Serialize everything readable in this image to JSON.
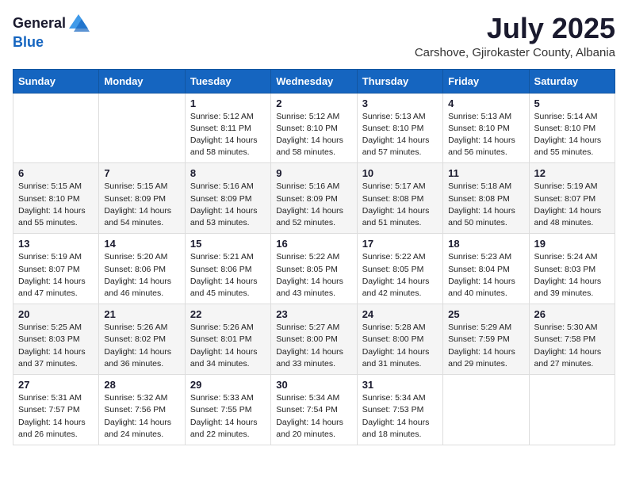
{
  "header": {
    "logo_general": "General",
    "logo_blue": "Blue",
    "month": "July 2025",
    "location": "Carshove, Gjirokaster County, Albania"
  },
  "weekdays": [
    "Sunday",
    "Monday",
    "Tuesday",
    "Wednesday",
    "Thursday",
    "Friday",
    "Saturday"
  ],
  "weeks": [
    [
      {
        "day": "",
        "sunrise": "",
        "sunset": "",
        "daylight": ""
      },
      {
        "day": "",
        "sunrise": "",
        "sunset": "",
        "daylight": ""
      },
      {
        "day": "1",
        "sunrise": "Sunrise: 5:12 AM",
        "sunset": "Sunset: 8:11 PM",
        "daylight": "Daylight: 14 hours and 58 minutes."
      },
      {
        "day": "2",
        "sunrise": "Sunrise: 5:12 AM",
        "sunset": "Sunset: 8:10 PM",
        "daylight": "Daylight: 14 hours and 58 minutes."
      },
      {
        "day": "3",
        "sunrise": "Sunrise: 5:13 AM",
        "sunset": "Sunset: 8:10 PM",
        "daylight": "Daylight: 14 hours and 57 minutes."
      },
      {
        "day": "4",
        "sunrise": "Sunrise: 5:13 AM",
        "sunset": "Sunset: 8:10 PM",
        "daylight": "Daylight: 14 hours and 56 minutes."
      },
      {
        "day": "5",
        "sunrise": "Sunrise: 5:14 AM",
        "sunset": "Sunset: 8:10 PM",
        "daylight": "Daylight: 14 hours and 55 minutes."
      }
    ],
    [
      {
        "day": "6",
        "sunrise": "Sunrise: 5:15 AM",
        "sunset": "Sunset: 8:10 PM",
        "daylight": "Daylight: 14 hours and 55 minutes."
      },
      {
        "day": "7",
        "sunrise": "Sunrise: 5:15 AM",
        "sunset": "Sunset: 8:09 PM",
        "daylight": "Daylight: 14 hours and 54 minutes."
      },
      {
        "day": "8",
        "sunrise": "Sunrise: 5:16 AM",
        "sunset": "Sunset: 8:09 PM",
        "daylight": "Daylight: 14 hours and 53 minutes."
      },
      {
        "day": "9",
        "sunrise": "Sunrise: 5:16 AM",
        "sunset": "Sunset: 8:09 PM",
        "daylight": "Daylight: 14 hours and 52 minutes."
      },
      {
        "day": "10",
        "sunrise": "Sunrise: 5:17 AM",
        "sunset": "Sunset: 8:08 PM",
        "daylight": "Daylight: 14 hours and 51 minutes."
      },
      {
        "day": "11",
        "sunrise": "Sunrise: 5:18 AM",
        "sunset": "Sunset: 8:08 PM",
        "daylight": "Daylight: 14 hours and 50 minutes."
      },
      {
        "day": "12",
        "sunrise": "Sunrise: 5:19 AM",
        "sunset": "Sunset: 8:07 PM",
        "daylight": "Daylight: 14 hours and 48 minutes."
      }
    ],
    [
      {
        "day": "13",
        "sunrise": "Sunrise: 5:19 AM",
        "sunset": "Sunset: 8:07 PM",
        "daylight": "Daylight: 14 hours and 47 minutes."
      },
      {
        "day": "14",
        "sunrise": "Sunrise: 5:20 AM",
        "sunset": "Sunset: 8:06 PM",
        "daylight": "Daylight: 14 hours and 46 minutes."
      },
      {
        "day": "15",
        "sunrise": "Sunrise: 5:21 AM",
        "sunset": "Sunset: 8:06 PM",
        "daylight": "Daylight: 14 hours and 45 minutes."
      },
      {
        "day": "16",
        "sunrise": "Sunrise: 5:22 AM",
        "sunset": "Sunset: 8:05 PM",
        "daylight": "Daylight: 14 hours and 43 minutes."
      },
      {
        "day": "17",
        "sunrise": "Sunrise: 5:22 AM",
        "sunset": "Sunset: 8:05 PM",
        "daylight": "Daylight: 14 hours and 42 minutes."
      },
      {
        "day": "18",
        "sunrise": "Sunrise: 5:23 AM",
        "sunset": "Sunset: 8:04 PM",
        "daylight": "Daylight: 14 hours and 40 minutes."
      },
      {
        "day": "19",
        "sunrise": "Sunrise: 5:24 AM",
        "sunset": "Sunset: 8:03 PM",
        "daylight": "Daylight: 14 hours and 39 minutes."
      }
    ],
    [
      {
        "day": "20",
        "sunrise": "Sunrise: 5:25 AM",
        "sunset": "Sunset: 8:03 PM",
        "daylight": "Daylight: 14 hours and 37 minutes."
      },
      {
        "day": "21",
        "sunrise": "Sunrise: 5:26 AM",
        "sunset": "Sunset: 8:02 PM",
        "daylight": "Daylight: 14 hours and 36 minutes."
      },
      {
        "day": "22",
        "sunrise": "Sunrise: 5:26 AM",
        "sunset": "Sunset: 8:01 PM",
        "daylight": "Daylight: 14 hours and 34 minutes."
      },
      {
        "day": "23",
        "sunrise": "Sunrise: 5:27 AM",
        "sunset": "Sunset: 8:00 PM",
        "daylight": "Daylight: 14 hours and 33 minutes."
      },
      {
        "day": "24",
        "sunrise": "Sunrise: 5:28 AM",
        "sunset": "Sunset: 8:00 PM",
        "daylight": "Daylight: 14 hours and 31 minutes."
      },
      {
        "day": "25",
        "sunrise": "Sunrise: 5:29 AM",
        "sunset": "Sunset: 7:59 PM",
        "daylight": "Daylight: 14 hours and 29 minutes."
      },
      {
        "day": "26",
        "sunrise": "Sunrise: 5:30 AM",
        "sunset": "Sunset: 7:58 PM",
        "daylight": "Daylight: 14 hours and 27 minutes."
      }
    ],
    [
      {
        "day": "27",
        "sunrise": "Sunrise: 5:31 AM",
        "sunset": "Sunset: 7:57 PM",
        "daylight": "Daylight: 14 hours and 26 minutes."
      },
      {
        "day": "28",
        "sunrise": "Sunrise: 5:32 AM",
        "sunset": "Sunset: 7:56 PM",
        "daylight": "Daylight: 14 hours and 24 minutes."
      },
      {
        "day": "29",
        "sunrise": "Sunrise: 5:33 AM",
        "sunset": "Sunset: 7:55 PM",
        "daylight": "Daylight: 14 hours and 22 minutes."
      },
      {
        "day": "30",
        "sunrise": "Sunrise: 5:34 AM",
        "sunset": "Sunset: 7:54 PM",
        "daylight": "Daylight: 14 hours and 20 minutes."
      },
      {
        "day": "31",
        "sunrise": "Sunrise: 5:34 AM",
        "sunset": "Sunset: 7:53 PM",
        "daylight": "Daylight: 14 hours and 18 minutes."
      },
      {
        "day": "",
        "sunrise": "",
        "sunset": "",
        "daylight": ""
      },
      {
        "day": "",
        "sunrise": "",
        "sunset": "",
        "daylight": ""
      }
    ]
  ]
}
